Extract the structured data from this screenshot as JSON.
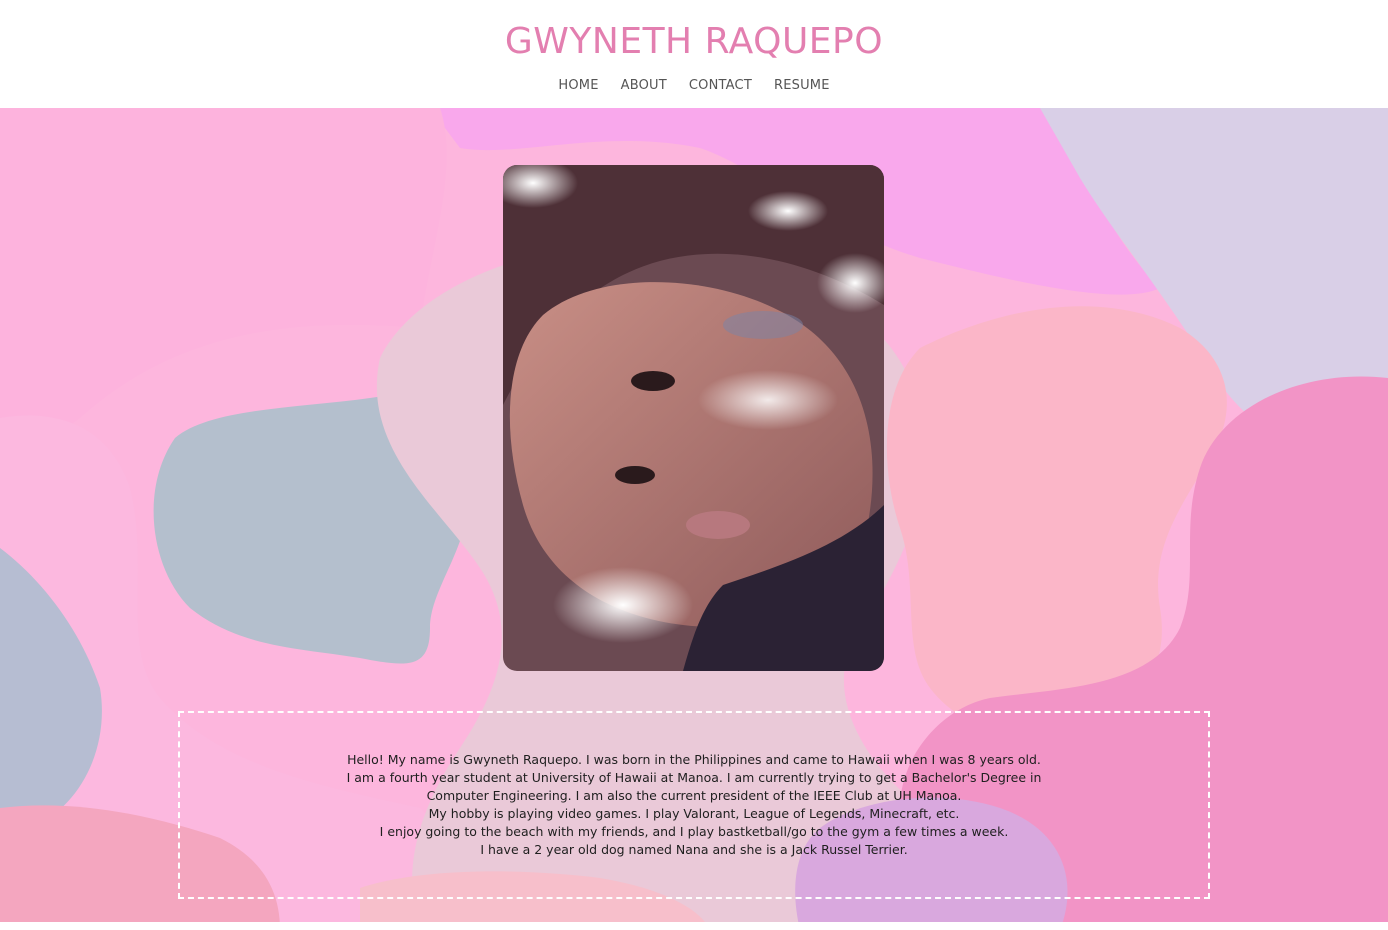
{
  "header": {
    "title": "GWYNETH RAQUEPO",
    "nav": [
      "HOME",
      "ABOUT",
      "CONTACT",
      "RESUME"
    ]
  },
  "bio": {
    "lines": [
      "Hello! My name is Gwyneth Raquepo. I was born in the Philippines and came to Hawaii when I was 8 years old.",
      "I am a fourth year student at University of Hawaii at Manoa. I am currently trying to get a Bachelor's Degree in",
      "Computer Engineering. I am also the current president of the IEEE Club at UH Manoa.",
      "My hobby is playing video games. I play Valorant, League of Legends, Minecraft, etc.",
      "I enjoy going to the beach with my friends, and I play bastketball/go to the gym a few times a week.",
      "I have a 2 year old dog named Nana and she is a Jack Russel Terrier."
    ]
  },
  "colors": {
    "title": "#e37fb0",
    "nav_text": "#555555",
    "bg_pink_light": "#fdb6dd",
    "bg_pink_mid": "#fcaee0",
    "bg_magenta": "#f3a7ee",
    "bg_lavender": "#d9cfe7",
    "bg_slate": "#b4bfcd",
    "bg_blush": "#eac9d8",
    "bg_rose": "#f294c6",
    "bg_peach": "#fbb6c8",
    "border_dashed": "#ffffff"
  },
  "icons": {
    "photo": "profile-photo"
  }
}
